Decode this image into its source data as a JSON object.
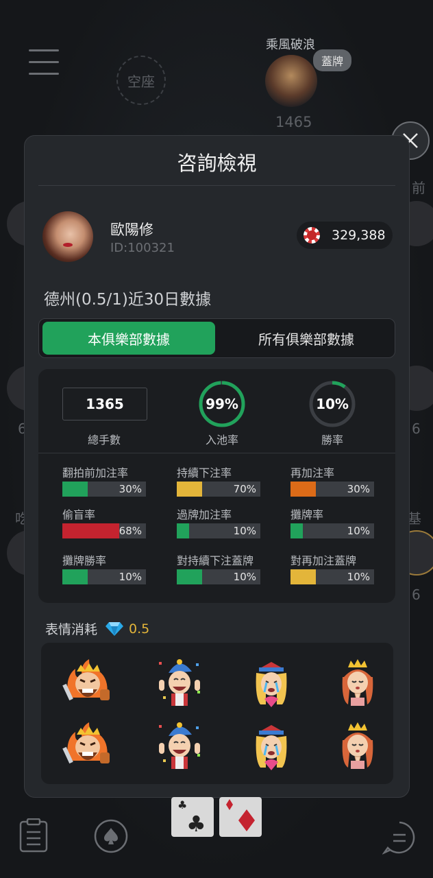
{
  "background": {
    "top_player": {
      "name": "乘風破浪",
      "badge": "蓋牌",
      "chips": "1465"
    },
    "empty_seat": "空座",
    "side_fragments": [
      "前",
      "6",
      "6",
      "6",
      "基",
      "吃"
    ]
  },
  "modal": {
    "title": "咨詢檢視",
    "player": {
      "name": "歐陽修",
      "id": "ID:100321",
      "chips": "329,388"
    },
    "stats_heading": "德州(0.5/1)近30日數據",
    "tabs": [
      {
        "label": "本俱樂部數據",
        "active": true
      },
      {
        "label": "所有俱樂部數據",
        "active": false
      }
    ],
    "summary": {
      "hands": {
        "value": "1365",
        "label": "總手數"
      },
      "vpip": {
        "value": "99%",
        "label": "入池率",
        "fraction": 0.99
      },
      "win_rate": {
        "value": "10%",
        "label": "勝率",
        "fraction": 0.1
      }
    },
    "bars": [
      {
        "label": "翻拍前加注率",
        "value": "30%",
        "fraction": 0.3,
        "color": "#21a25b"
      },
      {
        "label": "持續下注率",
        "value": "70%",
        "fraction": 0.3,
        "color": "#e3b53a"
      },
      {
        "label": "再加注率",
        "value": "30%",
        "fraction": 0.3,
        "color": "#dc6b18"
      },
      {
        "label": "偷盲率",
        "value": "68%",
        "fraction": 0.68,
        "color": "#c4232f"
      },
      {
        "label": "過牌加注率",
        "value": "10%",
        "fraction": 0.15,
        "color": "#21a25b"
      },
      {
        "label": "攤牌率",
        "value": "10%",
        "fraction": 0.15,
        "color": "#21a25b"
      },
      {
        "label": "攤牌勝率",
        "value": "10%",
        "fraction": 0.3,
        "color": "#21a25b"
      },
      {
        "label": "對持續下注蓋牌",
        "value": "10%",
        "fraction": 0.3,
        "color": "#21a25b"
      },
      {
        "label": "對再加注蓋牌",
        "value": "10%",
        "fraction": 0.3,
        "color": "#e3b53a"
      }
    ],
    "emote_heading": "表情消耗",
    "emote_cost": "0.5",
    "emotes": [
      "angry-king",
      "jester-cheer",
      "crying-queen",
      "praying-princess",
      "angry-king",
      "jester-cheer",
      "crying-queen",
      "praying-princess"
    ]
  },
  "colors": {
    "accent": "#21a25b",
    "gold": "#e3b53a",
    "panel": "#25282c"
  }
}
